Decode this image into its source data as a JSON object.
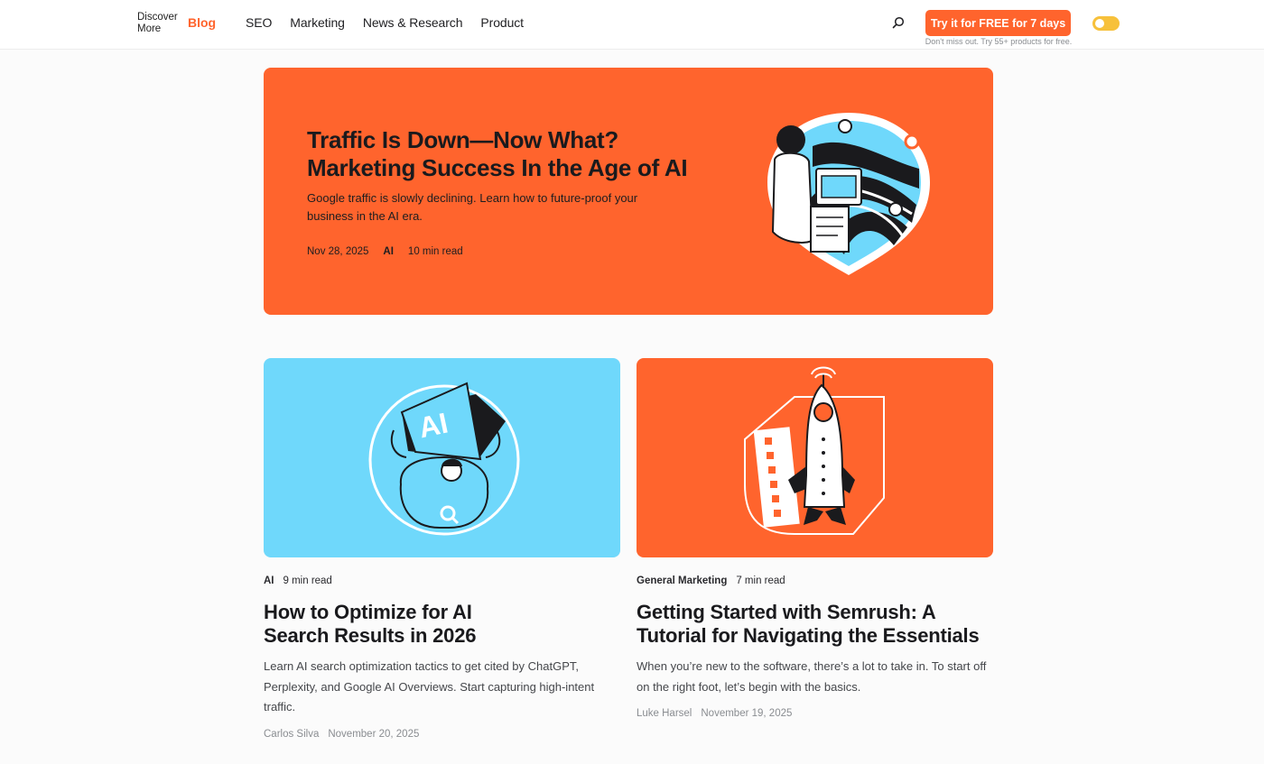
{
  "header": {
    "logo_small": "Discover More",
    "logo_blog": "Blog",
    "nav": [
      "SEO",
      "Marketing",
      "News & Research",
      "Product"
    ],
    "cta_label": "Try it for FREE for 7 days",
    "cta_note": "Don't miss out. Try 55+ products for free."
  },
  "hero": {
    "title": "Traffic Is Down—Now What? Marketing Success In the Age of AI",
    "description": "Google traffic is slowly declining. Learn how to future-proof your business in the AI era.",
    "date": "Nov 28, 2025",
    "category": "AI",
    "read_time": "10 min read",
    "bg_color": "#ff642d",
    "illustration": "marketer-map-pins-icon"
  },
  "cards": [
    {
      "category": "AI",
      "read_time": "9 min read",
      "title": "How to Optimize for AI Search Results in 2026",
      "description": "Learn AI search optimization tactics to get cited by ChatGPT, Perplexity, and Google AI Overviews. Start capturing high-intent traffic.",
      "author": "Carlos Silva",
      "date": "November 20, 2025",
      "bg_color": "#6fd8fb",
      "illustration": "person-holding-ai-box-icon"
    },
    {
      "category": "General Marketing",
      "read_time": "7 min read",
      "title": "Getting Started with Semrush: A Tutorial for Navigating the Essentials",
      "description": "When you’re new to the software, there’s a lot to take in. To start off on the right foot, let’s begin with the basics.",
      "author": "Luke Harsel",
      "date": "November 19, 2025",
      "bg_color": "#ff642d",
      "illustration": "rocket-checklist-icon"
    }
  ],
  "colors": {
    "accent": "#ff642d",
    "toggle": "#f7c13b"
  }
}
